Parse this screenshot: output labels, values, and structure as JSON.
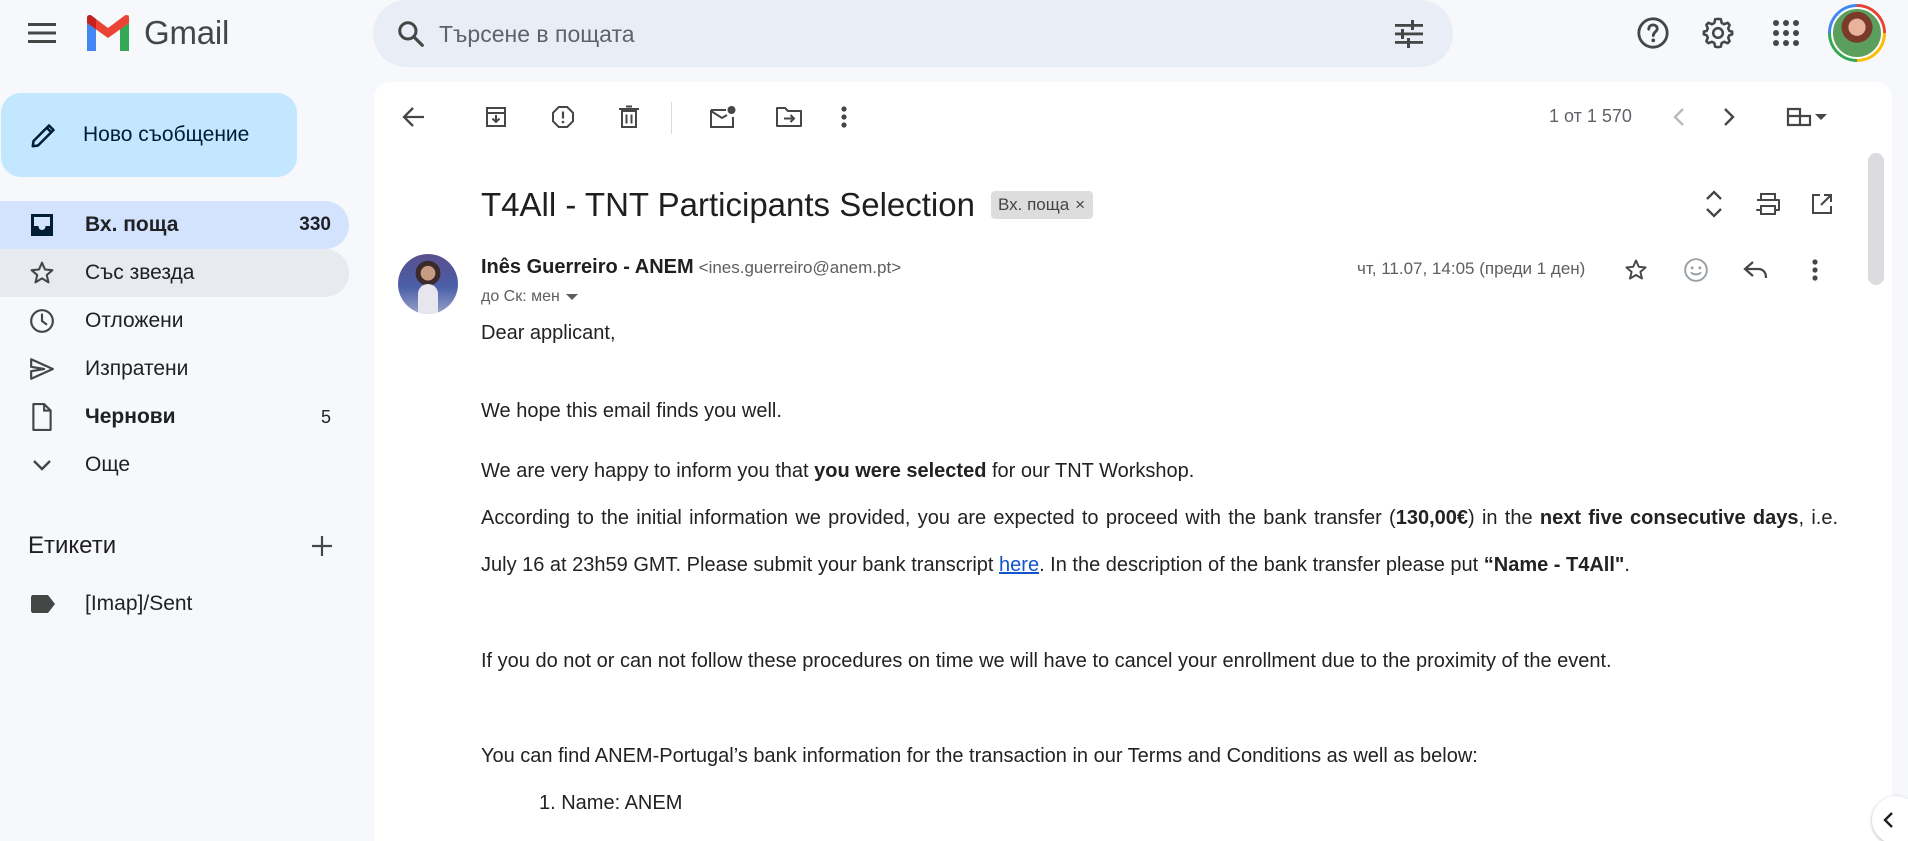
{
  "app": {
    "name": "Gmail",
    "brand_colors": {
      "red": "#ea4335",
      "blue": "#4285f4",
      "green": "#34a853",
      "yellow": "#fbbc04"
    }
  },
  "search": {
    "placeholder": "Търсене в пощата",
    "value": ""
  },
  "topbar_icons": [
    "menu-icon",
    "search-icon",
    "tune-icon",
    "help-icon",
    "gear-icon",
    "apps-grid-icon",
    "account-avatar"
  ],
  "compose": {
    "label": "Ново съобщение",
    "color": "#c2e7ff"
  },
  "sidebar": {
    "items": [
      {
        "label": "Вх. поща",
        "count": "330",
        "icon": "inbox-icon",
        "state": "active"
      },
      {
        "label": "Със звезда",
        "count": "",
        "icon": "star-icon",
        "state": "hover"
      },
      {
        "label": "Отложени",
        "count": "",
        "icon": "clock-icon",
        "state": ""
      },
      {
        "label": "Изпратени",
        "count": "",
        "icon": "send-icon",
        "state": ""
      },
      {
        "label": "Чернови",
        "count": "5",
        "icon": "draft-icon",
        "state": "bold"
      },
      {
        "label": "Още",
        "count": "",
        "icon": "chevron-down-icon",
        "state": ""
      }
    ],
    "labels_title": "Етикети",
    "labels": [
      {
        "label": "[Imap]/Sent",
        "icon": "label-icon"
      }
    ]
  },
  "toolbar": {
    "pager": "1 от 1 570",
    "icons": [
      "back-icon",
      "archive-icon",
      "report-spam-icon",
      "delete-icon",
      "mark-unread-icon",
      "move-to-icon",
      "more-vert-icon",
      "newer-icon",
      "older-icon",
      "view-split-icon"
    ]
  },
  "email": {
    "subject": "T4All - TNT Participants Selection",
    "tag": "Вх. поща",
    "tag_close": "×",
    "sender_name": "Inês Guerreiro - ANEM",
    "sender_email": "<ines.guerreiro@anem.pt>",
    "to_line": "до Ск: мен",
    "date": "чт, 11.07, 14:05 (преди 1 ден)",
    "body": {
      "greeting": "Dear applicant,",
      "p1": "We hope this email finds you well.",
      "p2_a": "We are very happy to inform you that ",
      "p2_b": "you were selected",
      "p2_c": " for our TNT Workshop.",
      "p3_a": "According to the initial information we provided, you are expected to proceed with the bank transfer (",
      "p3_b": "130,00€",
      "p3_c": ") in the ",
      "p3_d": "next five consecutive days",
      "p3_e": ", i.e. July 16 at 23h59 GMT. Please submit your bank transcript ",
      "p3_link": "here",
      "p3_f": ". In the description of the bank transfer please put ",
      "p3_g": "“Name - T4All\"",
      "p3_h": ".",
      "p4": "If you do not or can not follow these procedures on time we will have to cancel your enrollment due to the proximity of the event.",
      "p5": "You can find ANEM-Portugal’s bank information for the transaction in our Terms and Conditions as well as below:",
      "list": [
        "1. Name: ANEM"
      ]
    }
  }
}
